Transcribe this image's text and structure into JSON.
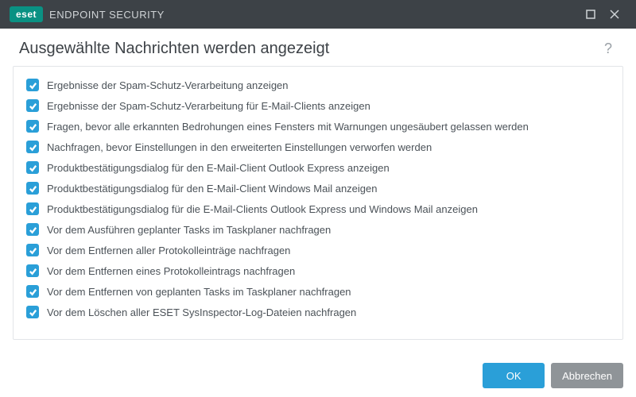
{
  "titlebar": {
    "brand_badge": "eset",
    "brand_text": "ENDPOINT SECURITY"
  },
  "header": {
    "title": "Ausgewählte Nachrichten werden angezeigt",
    "help": "?"
  },
  "items": [
    {
      "checked": true,
      "label": "Ergebnisse der Spam-Schutz-Verarbeitung anzeigen"
    },
    {
      "checked": true,
      "label": "Ergebnisse der Spam-Schutz-Verarbeitung für E-Mail-Clients anzeigen"
    },
    {
      "checked": true,
      "label": "Fragen, bevor alle erkannten Bedrohungen eines Fensters mit Warnungen ungesäubert gelassen werden"
    },
    {
      "checked": true,
      "label": "Nachfragen, bevor Einstellungen in den erweiterten Einstellungen verworfen werden"
    },
    {
      "checked": true,
      "label": "Produktbestätigungsdialog für den E-Mail-Client Outlook Express anzeigen"
    },
    {
      "checked": true,
      "label": "Produktbestätigungsdialog für den E-Mail-Client Windows Mail anzeigen"
    },
    {
      "checked": true,
      "label": "Produktbestätigungsdialog für die E-Mail-Clients Outlook Express und Windows Mail anzeigen"
    },
    {
      "checked": true,
      "label": "Vor dem Ausführen geplanter Tasks im Taskplaner nachfragen"
    },
    {
      "checked": true,
      "label": "Vor dem Entfernen aller Protokolleinträge nachfragen"
    },
    {
      "checked": true,
      "label": "Vor dem Entfernen eines Protokolleintrags nachfragen"
    },
    {
      "checked": true,
      "label": "Vor dem Entfernen von geplanten Tasks im Taskplaner nachfragen"
    },
    {
      "checked": true,
      "label": "Vor dem Löschen aller ESET SysInspector-Log-Dateien nachfragen"
    }
  ],
  "footer": {
    "ok": "OK",
    "cancel": "Abbrechen"
  }
}
